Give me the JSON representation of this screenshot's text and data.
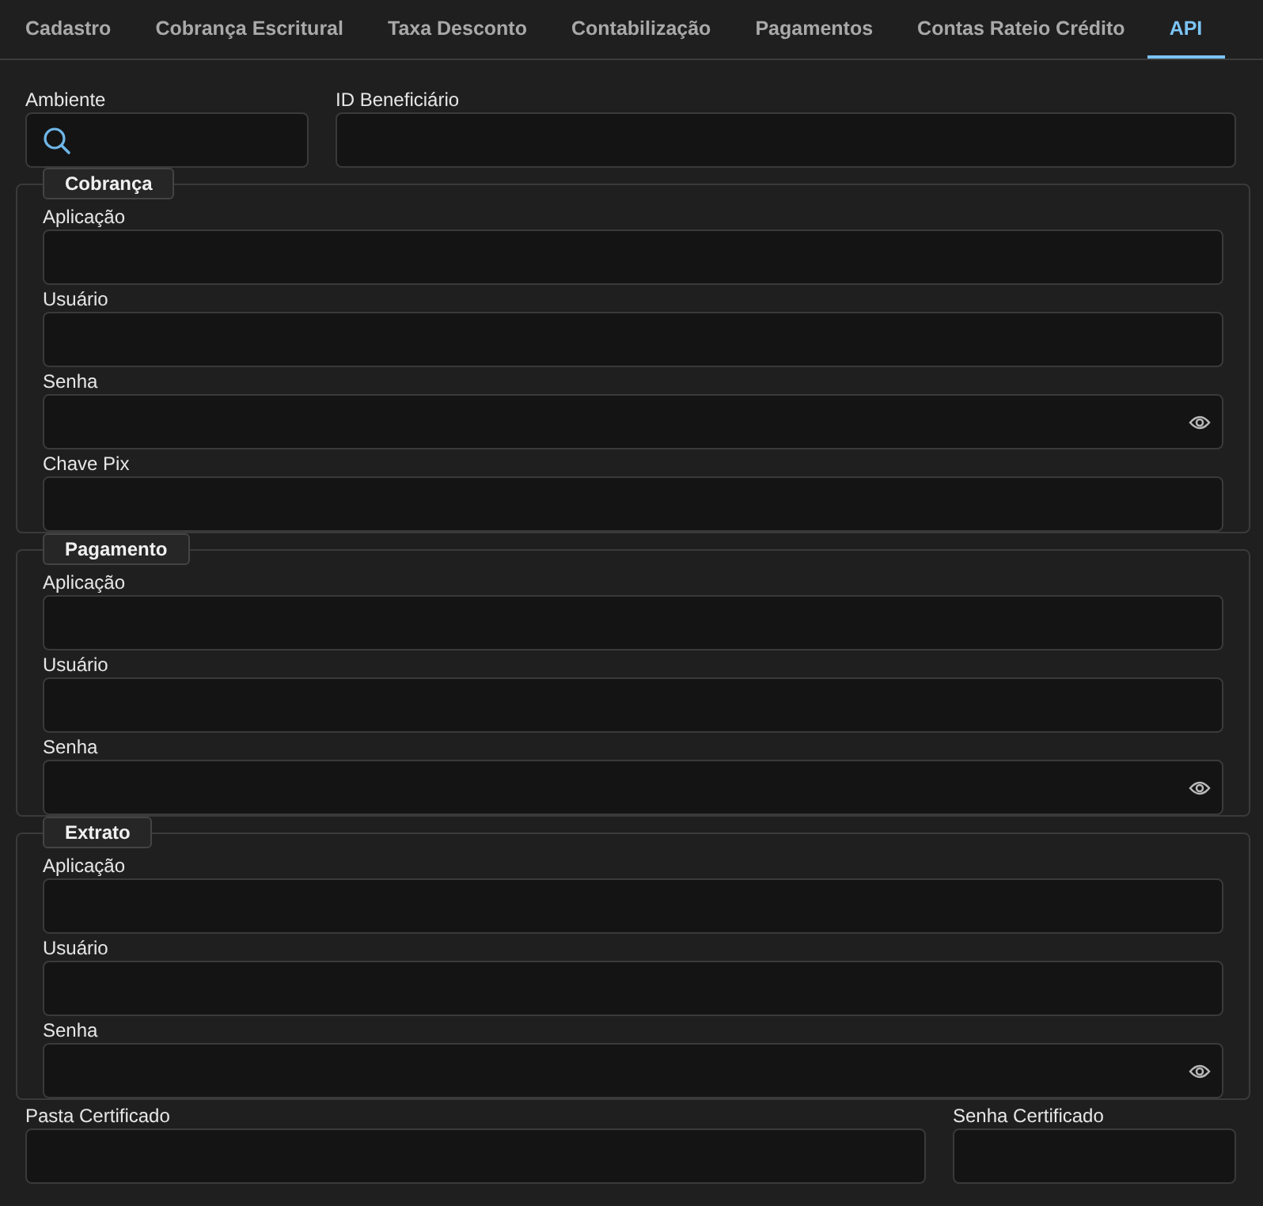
{
  "tabs": [
    {
      "label": "Cadastro",
      "selected": false
    },
    {
      "label": "Cobrança Escritural",
      "selected": false
    },
    {
      "label": "Taxa Desconto",
      "selected": false
    },
    {
      "label": "Contabilização",
      "selected": false
    },
    {
      "label": "Pagamentos",
      "selected": false
    },
    {
      "label": "Contas Rateio Crédito",
      "selected": false
    },
    {
      "label": "API",
      "selected": true
    }
  ],
  "top_fields": [
    {
      "label": "Ambiente",
      "kind": "search"
    },
    {
      "label": "ID Beneficiário",
      "kind": "text"
    }
  ],
  "groups": [
    {
      "title": "Cobrança",
      "fields": [
        {
          "label": "Aplicação",
          "kind": "text"
        },
        {
          "label": "Usuário",
          "kind": "text"
        },
        {
          "label": "Senha",
          "kind": "password"
        },
        {
          "label": "Chave Pix",
          "kind": "text"
        }
      ]
    },
    {
      "title": "Pagamento",
      "fields": [
        {
          "label": "Aplicação",
          "kind": "text"
        },
        {
          "label": "Usuário",
          "kind": "text"
        },
        {
          "label": "Senha",
          "kind": "password"
        }
      ]
    },
    {
      "title": "Extrato",
      "fields": [
        {
          "label": "Aplicação",
          "kind": "text"
        },
        {
          "label": "Usuário",
          "kind": "text"
        },
        {
          "label": "Senha",
          "kind": "password"
        }
      ]
    }
  ],
  "bottom_fields": [
    {
      "label": "Pasta Certificado"
    },
    {
      "label": "Senha Certificado"
    }
  ]
}
